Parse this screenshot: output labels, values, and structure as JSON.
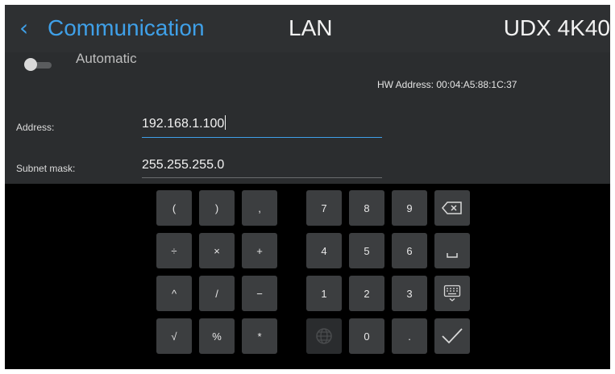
{
  "header": {
    "back_glyph": "‹",
    "title": "Communication",
    "center": "LAN",
    "device": "UDX 4K40"
  },
  "form": {
    "automatic_label": "Automatic",
    "hw_address": "HW Address:  00:04:A5:88:1C:37",
    "address_label": "Address:",
    "address_value": "192.168.1.100",
    "subnet_label": "Subnet mask:",
    "subnet_value": "255.255.255.0"
  },
  "keypad": {
    "k_lparen": "(",
    "k_rparen": ")",
    "k_comma": ",",
    "k_divide": "÷",
    "k_times": "×",
    "k_plus": "+",
    "k_caret": "^",
    "k_slash": "/",
    "k_minus": "−",
    "k_sqrt": "√",
    "k_percent": "%",
    "k_asterisk": "*",
    "k_7": "7",
    "k_8": "8",
    "k_9": "9",
    "k_4": "4",
    "k_5": "5",
    "k_6": "6",
    "k_1": "1",
    "k_2": "2",
    "k_3": "3",
    "k_0": "0",
    "k_dot": "."
  },
  "colors": {
    "accent": "#3fa0e8",
    "header_bg": "#2e3032",
    "panel_bg": "#2b2d2f",
    "key_bg": "#3c3e40"
  },
  "icons": [
    "back-chevron-icon",
    "backspace-icon",
    "space-icon",
    "keyboard-icon",
    "globe-icon",
    "checkmark-icon"
  ]
}
